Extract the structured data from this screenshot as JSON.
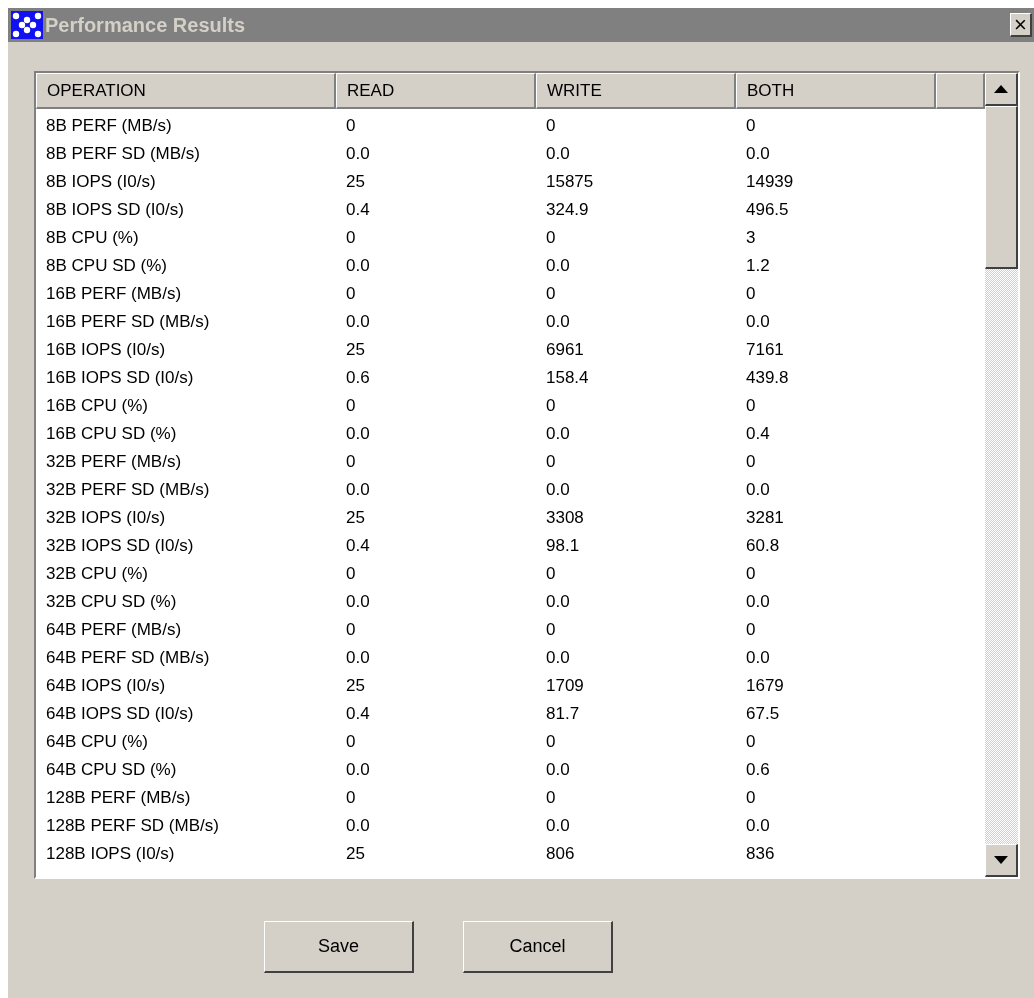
{
  "window": {
    "title": "Performance Results",
    "close": "×"
  },
  "table": {
    "columns": [
      "OPERATION",
      "READ",
      "WRITE",
      "BOTH"
    ],
    "rows": [
      [
        "8B PERF (MB/s)",
        "0",
        "0",
        "0"
      ],
      [
        "8B PERF SD (MB/s)",
        "0.0",
        "0.0",
        "0.0"
      ],
      [
        "8B IOPS (I0/s)",
        "25",
        "15875",
        "14939"
      ],
      [
        "8B IOPS SD (I0/s)",
        "0.4",
        "324.9",
        "496.5"
      ],
      [
        "8B CPU (%)",
        "0",
        "0",
        "3"
      ],
      [
        "8B CPU SD (%)",
        "0.0",
        "0.0",
        "1.2"
      ],
      [
        "16B PERF (MB/s)",
        "0",
        "0",
        "0"
      ],
      [
        "16B PERF SD (MB/s)",
        "0.0",
        "0.0",
        "0.0"
      ],
      [
        "16B IOPS (I0/s)",
        "25",
        "6961",
        "7161"
      ],
      [
        "16B IOPS SD (I0/s)",
        "0.6",
        "158.4",
        "439.8"
      ],
      [
        "16B CPU (%)",
        "0",
        "0",
        "0"
      ],
      [
        "16B CPU SD (%)",
        "0.0",
        "0.0",
        "0.4"
      ],
      [
        "32B PERF (MB/s)",
        "0",
        "0",
        "0"
      ],
      [
        "32B PERF SD (MB/s)",
        "0.0",
        "0.0",
        "0.0"
      ],
      [
        "32B IOPS (I0/s)",
        "25",
        "3308",
        "3281"
      ],
      [
        "32B IOPS SD (I0/s)",
        "0.4",
        "98.1",
        "60.8"
      ],
      [
        "32B CPU (%)",
        "0",
        "0",
        "0"
      ],
      [
        "32B CPU SD (%)",
        "0.0",
        "0.0",
        "0.0"
      ],
      [
        "64B PERF (MB/s)",
        "0",
        "0",
        "0"
      ],
      [
        "64B PERF SD (MB/s)",
        "0.0",
        "0.0",
        "0.0"
      ],
      [
        "64B IOPS (I0/s)",
        "25",
        "1709",
        "1679"
      ],
      [
        "64B IOPS SD (I0/s)",
        "0.4",
        "81.7",
        "67.5"
      ],
      [
        "64B CPU (%)",
        "0",
        "0",
        "0"
      ],
      [
        "64B CPU SD (%)",
        "0.0",
        "0.0",
        "0.6"
      ],
      [
        "128B PERF (MB/s)",
        "0",
        "0",
        "0"
      ],
      [
        "128B PERF SD (MB/s)",
        "0.0",
        "0.0",
        "0.0"
      ],
      [
        "128B IOPS (I0/s)",
        "25",
        "806",
        "836"
      ]
    ]
  },
  "buttons": [
    "Save",
    "Cancel"
  ]
}
